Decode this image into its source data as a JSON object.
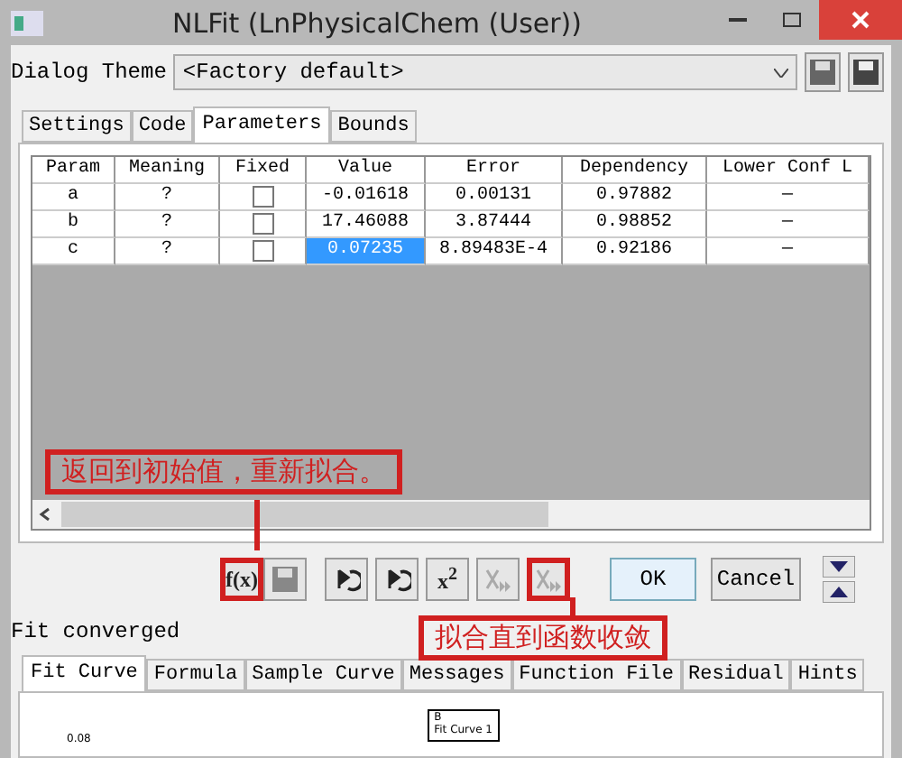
{
  "window": {
    "title": "NLFit (LnPhysicalChem (User))"
  },
  "theme": {
    "label": "Dialog Theme",
    "value": "<Factory default>"
  },
  "tabs": [
    {
      "label": "Settings",
      "selected": false
    },
    {
      "label": "Code",
      "selected": false
    },
    {
      "label": "Parameters",
      "selected": true
    },
    {
      "label": "Bounds",
      "selected": false
    }
  ],
  "table": {
    "columns": [
      "Param",
      "Meaning",
      "Fixed",
      "Value",
      "Error",
      "Dependency",
      "Lower Conf L"
    ],
    "rows": [
      {
        "param": "a",
        "meaning": "?",
        "fixed": false,
        "value": "-0.01618",
        "selected": false,
        "error": "0.00131",
        "dependency": "0.97882",
        "lower": "—"
      },
      {
        "param": "b",
        "meaning": "?",
        "fixed": false,
        "value": "17.46088",
        "selected": false,
        "error": "3.87444",
        "dependency": "0.98852",
        "lower": "—"
      },
      {
        "param": "c",
        "meaning": "?",
        "fixed": false,
        "value": "0.07235",
        "selected": true,
        "error": "8.89483E-4",
        "dependency": "0.92186",
        "lower": "—"
      }
    ]
  },
  "toolbar": [
    {
      "kind": "fx",
      "label": "f(x)",
      "disabled": false,
      "highlighted": true
    },
    {
      "kind": "save",
      "disabled": true,
      "highlighted": false
    },
    {
      "kind": "undo",
      "disabled": false,
      "highlighted": false
    },
    {
      "kind": "undo-s",
      "disabled": false,
      "highlighted": false
    },
    {
      "kind": "chi",
      "label": "x$^{2}$",
      "disabled": false,
      "highlighted": false
    },
    {
      "kind": "step",
      "disabled": true,
      "highlighted": false
    },
    {
      "kind": "converge",
      "disabled": true,
      "highlighted": true
    }
  ],
  "buttons": [
    {
      "label": "OK",
      "default": true
    },
    {
      "label": "Cancel",
      "default": false
    }
  ],
  "annotations": [
    {
      "text": "返回到初始值，重新拟合。"
    },
    {
      "text": "拟合直到函数收敛"
    }
  ],
  "status": "Fit converged",
  "bottom_tabs": [
    {
      "label": "Fit Curve",
      "selected": true
    },
    {
      "label": "Formula",
      "selected": false
    },
    {
      "label": "Sample Curve",
      "selected": false
    },
    {
      "label": "Messages",
      "selected": false
    },
    {
      "label": "Function File",
      "selected": false
    },
    {
      "label": "Residual",
      "selected": false
    },
    {
      "label": "Hints",
      "selected": false
    }
  ],
  "plot": {
    "ytick": "0.08",
    "legend": [
      "B",
      "Fit Curve 1"
    ]
  }
}
